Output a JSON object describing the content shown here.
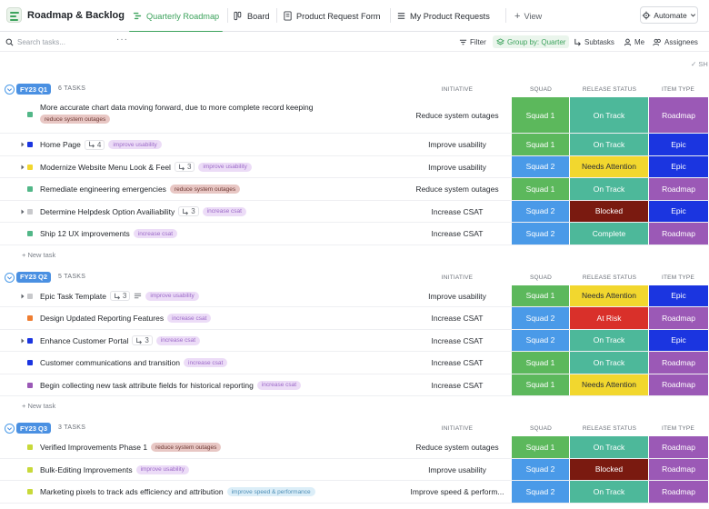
{
  "header": {
    "app_title": "Roadmap & Backlog",
    "tabs": [
      {
        "label": "Quarterly Roadmap",
        "icon": "gantt-icon",
        "active": true
      },
      {
        "label": "Board",
        "icon": "board-icon"
      },
      {
        "label": "Product Request Form",
        "icon": "form-icon"
      },
      {
        "label": "My Product Requests",
        "icon": "list-icon"
      }
    ],
    "add_view_label": "View",
    "automate_label": "Automate"
  },
  "toolbar": {
    "search_placeholder": "Search tasks...",
    "filter_label": "Filter",
    "group_by_label": "Group by: Quarter",
    "subtasks_label": "Subtasks",
    "me_label": "Me",
    "assignees_label": "Assignees",
    "show_label": "SH"
  },
  "columns": {
    "initiative": "INITIATIVE",
    "squad": "SQUAD",
    "release_status": "RELEASE STATUS",
    "item_type": "ITEM TYPE"
  },
  "colors": {
    "accent_green": "#3da35d",
    "squad_1": "#5cb85c",
    "squad_2": "#4a9ae8",
    "on_track": "#4db89a",
    "complete": "#4db89a",
    "needs_attention": "#f2d72e",
    "blocked": "#7a1a10",
    "at_risk": "#d9302a",
    "roadmap": "#9b59b6",
    "epic": "#1b35e0"
  },
  "new_task_label": "+ New task",
  "groups": [
    {
      "label": "FY23 Q1",
      "count": "6 TASKS",
      "tasks": [
        {
          "name": "More accurate chart data moving forward, due to more complete record keeping",
          "tag": "reduce system outages",
          "initiative": "Reduce system outages",
          "squad": "Squad 1",
          "status": "On Track",
          "type": "Roadmap",
          "dot": "#52b788",
          "caret": false,
          "subtasks": "",
          "wrap": true
        },
        {
          "name": "Home Page",
          "tag": "improve usability",
          "initiative": "Improve usability",
          "squad": "Squad 1",
          "status": "On Track",
          "type": "Epic",
          "dot": "#1b35e0",
          "caret": true,
          "subtasks": "4"
        },
        {
          "name": "Modernize Website Menu Look & Feel",
          "tag": "improve usability",
          "initiative": "Improve usability",
          "squad": "Squad 2",
          "status": "Needs Attention",
          "type": "Epic",
          "dot": "#f2d72e",
          "caret": true,
          "subtasks": "3"
        },
        {
          "name": "Remediate engineering emergencies",
          "tag": "reduce system outages",
          "initiative": "Reduce system outages",
          "squad": "Squad 1",
          "status": "On Track",
          "type": "Roadmap",
          "dot": "#52b788",
          "caret": false,
          "subtasks": ""
        },
        {
          "name": "Determine Helpdesk Option Availiability",
          "tag": "increase csat",
          "initiative": "Increase CSAT",
          "squad": "Squad 2",
          "status": "Blocked",
          "type": "Epic",
          "dot": "#c8c9cc",
          "caret": true,
          "subtasks": "3"
        },
        {
          "name": "Ship 12 UX improvements",
          "tag": "increase csat",
          "initiative": "Increase CSAT",
          "squad": "Squad 2",
          "status": "Complete",
          "type": "Roadmap",
          "dot": "#52b788",
          "caret": false,
          "subtasks": ""
        }
      ]
    },
    {
      "label": "FY23 Q2",
      "count": "5 TASKS",
      "tasks": [
        {
          "name": "Epic Task Template",
          "tag": "improve usability",
          "initiative": "Improve usability",
          "squad": "Squad 1",
          "status": "Needs Attention",
          "type": "Epic",
          "dot": "#c8c9cc",
          "caret": true,
          "subtasks": "3",
          "list_icon": true
        },
        {
          "name": "Design Updated Reporting Features",
          "tag": "increase csat",
          "initiative": "Increase CSAT",
          "squad": "Squad 2",
          "status": "At Risk",
          "type": "Roadmap",
          "dot": "#ef7d31",
          "caret": false,
          "subtasks": ""
        },
        {
          "name": "Enhance Customer Portal",
          "tag": "increase csat",
          "initiative": "Increase CSAT",
          "squad": "Squad 2",
          "status": "On Track",
          "type": "Epic",
          "dot": "#1b35e0",
          "caret": true,
          "subtasks": "3"
        },
        {
          "name": "Customer communications and transition",
          "tag": "increase csat",
          "initiative": "Increase CSAT",
          "squad": "Squad 1",
          "status": "On Track",
          "type": "Roadmap",
          "dot": "#1b35e0",
          "caret": false,
          "subtasks": ""
        },
        {
          "name": "Begin collecting new task attribute fields for historical reporting",
          "tag": "increase csat",
          "initiative": "Increase CSAT",
          "squad": "Squad 1",
          "status": "Needs Attention",
          "type": "Roadmap",
          "dot": "#9b59b6",
          "caret": false,
          "subtasks": ""
        }
      ]
    },
    {
      "label": "FY23 Q3",
      "count": "3 TASKS",
      "tasks": [
        {
          "name": "Verified Improvements Phase 1",
          "tag": "reduce system outages",
          "initiative": "Reduce system outages",
          "squad": "Squad 1",
          "status": "On Track",
          "type": "Roadmap",
          "dot": "#c8d93a",
          "caret": false,
          "subtasks": ""
        },
        {
          "name": "Bulk-Editing Improvements",
          "tag": "improve usability",
          "initiative": "Improve usability",
          "squad": "Squad 2",
          "status": "Blocked",
          "type": "Roadmap",
          "dot": "#c8d93a",
          "caret": false,
          "subtasks": ""
        },
        {
          "name": "Marketing pixels to track ads efficiency and attribution",
          "tag": "improve speed & performance",
          "initiative": "Improve speed & perform...",
          "squad": "Squad 2",
          "status": "On Track",
          "type": "Roadmap",
          "dot": "#c8d93a",
          "caret": false,
          "subtasks": ""
        }
      ]
    }
  ]
}
